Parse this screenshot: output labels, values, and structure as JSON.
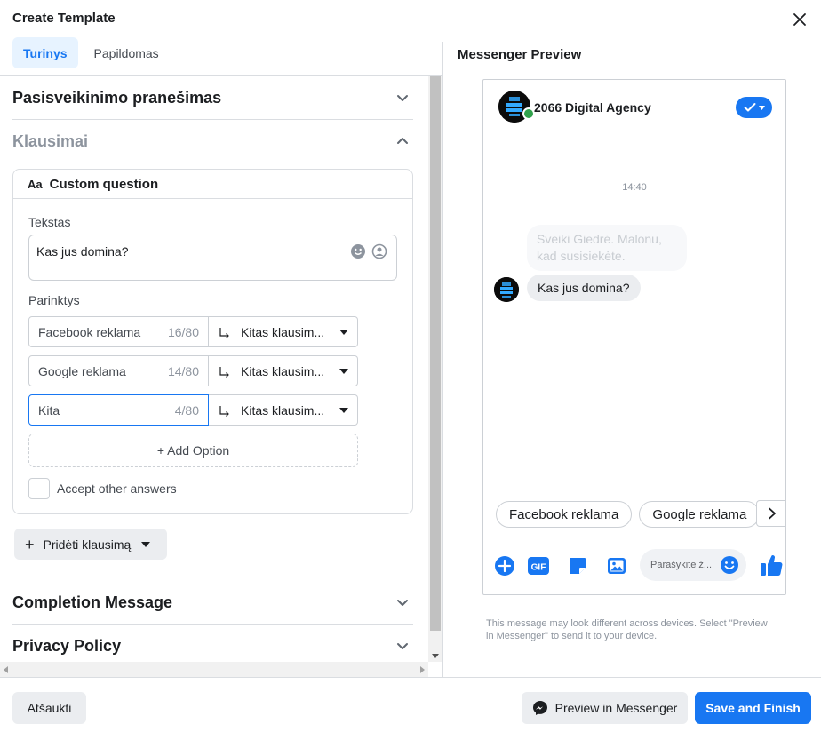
{
  "header": {
    "title": "Create Template"
  },
  "tabs": [
    {
      "label": "Turinys",
      "active": true
    },
    {
      "label": "Papildomas",
      "active": false
    }
  ],
  "sections": {
    "greeting": "Pasisveikinimo pranešimas",
    "questions": "Klausimai",
    "completion": "Completion Message",
    "privacy": "Privacy Policy"
  },
  "question_card": {
    "type_label": "Custom question",
    "type_icon": "Aa",
    "text_label": "Tekstas",
    "text_value": "Kas jus domina?",
    "options_label": "Parinktys",
    "options": [
      {
        "value": "Facebook reklama",
        "count": "16/80",
        "next": "Kitas klausim..."
      },
      {
        "value": "Google reklama",
        "count": "14/80",
        "next": "Kitas klausim..."
      },
      {
        "value": "Kita",
        "count": "4/80",
        "next": "Kitas klausim..."
      }
    ],
    "add_option": "+ Add Option",
    "accept_other": "Accept other answers"
  },
  "add_question": "Pridėti klausimą",
  "preview": {
    "title": "Messenger Preview",
    "page_name": "2066 Digital Agency",
    "timestamp": "14:40",
    "ghost_message": "Sveiki Giedrė. Malonu, kad susisiekėte.",
    "message": "Kas jus domina?",
    "quick_replies": [
      "Facebook reklama",
      "Google reklama"
    ],
    "composer_placeholder": "Parašykite ž...",
    "gif_label": "GIF",
    "disclaimer": "This message may look different across devices. Select \"Preview in Messenger\" to send it to your device."
  },
  "footer": {
    "cancel": "Atšaukti",
    "preview_in_messenger": "Preview in Messenger",
    "save": "Save and Finish"
  },
  "colors": {
    "accent": "#1877f2",
    "tab_active_bg": "#e7f3ff",
    "online": "#31a24c"
  }
}
